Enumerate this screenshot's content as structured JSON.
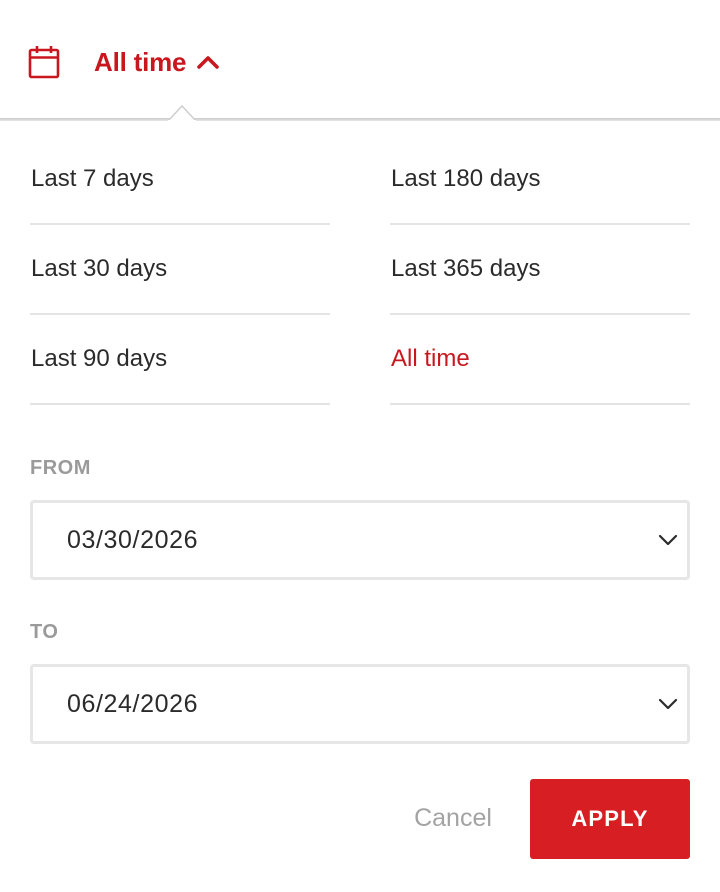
{
  "header": {
    "selected_label": "All time",
    "calendar_icon": "calendar-icon",
    "toggle_icon": "chevron-up-icon"
  },
  "presets": [
    {
      "label": "Last 7 days",
      "active": false
    },
    {
      "label": "Last 180 days",
      "active": false
    },
    {
      "label": "Last 30 days",
      "active": false
    },
    {
      "label": "Last 365 days",
      "active": false
    },
    {
      "label": "Last 90 days",
      "active": false
    },
    {
      "label": "All time",
      "active": true
    }
  ],
  "range": {
    "from_label": "FROM",
    "from_value": "03/30/2026",
    "to_label": "TO",
    "to_value": "06/24/2026"
  },
  "actions": {
    "cancel_label": "Cancel",
    "apply_label": "APPLY"
  },
  "colors": {
    "accent": "#c8171e",
    "apply_bg": "#d71e22",
    "muted_text": "#9a9a9a",
    "divider": "#e4e4e4"
  }
}
